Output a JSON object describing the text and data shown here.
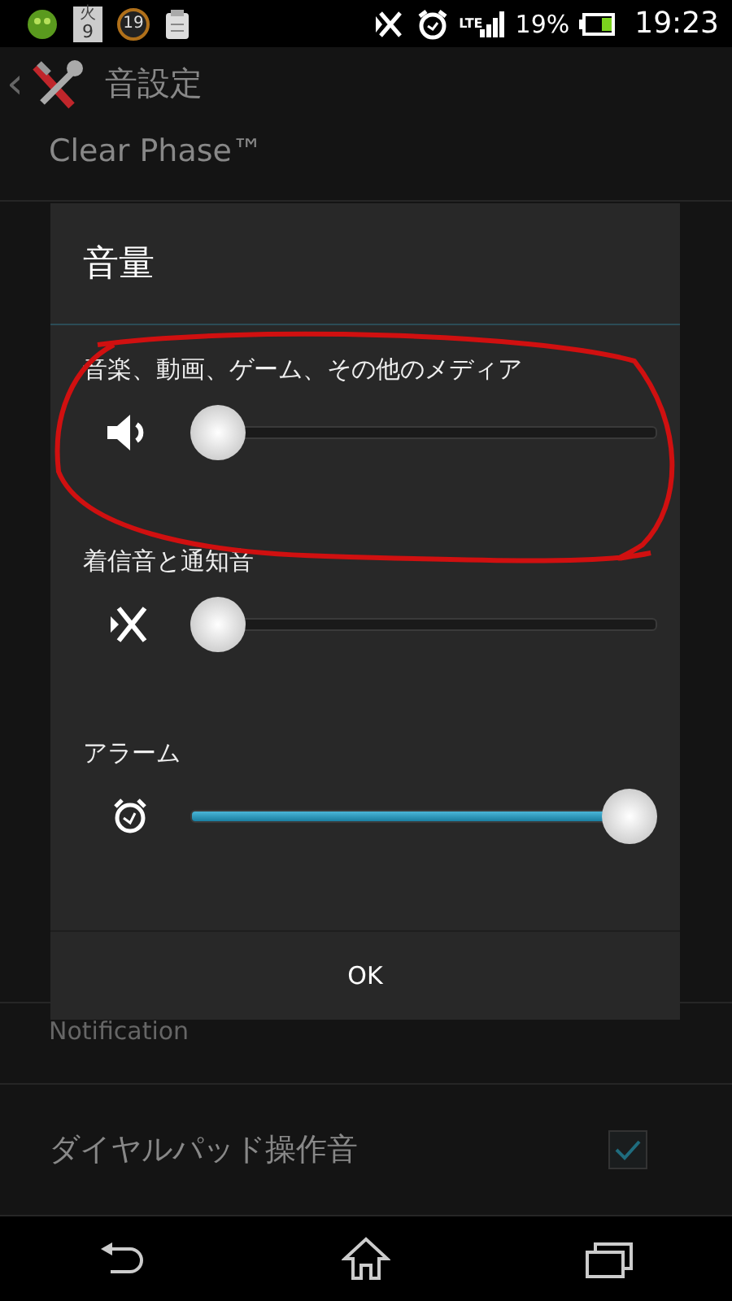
{
  "status_bar": {
    "calendar_day": "火",
    "calendar_date": "9",
    "badge": "19",
    "network": "LTE",
    "battery": "19%",
    "time": "19:23"
  },
  "header": {
    "back": "‹",
    "title": "音設定"
  },
  "settings": [
    {
      "kind": "text",
      "label": "Clear Phase™"
    },
    {
      "kind": "text",
      "label": "Notification"
    },
    {
      "kind": "check",
      "label": "ダイヤルパッド操作音",
      "checked": true
    }
  ],
  "dialog": {
    "title": "音量",
    "sliders": [
      {
        "label": "音楽、動画、ゲーム、その他のメディア",
        "level": 0
      },
      {
        "label": "着信音と通知音",
        "level": 0
      },
      {
        "label": "アラーム",
        "level": 1
      }
    ],
    "button": "OK"
  }
}
